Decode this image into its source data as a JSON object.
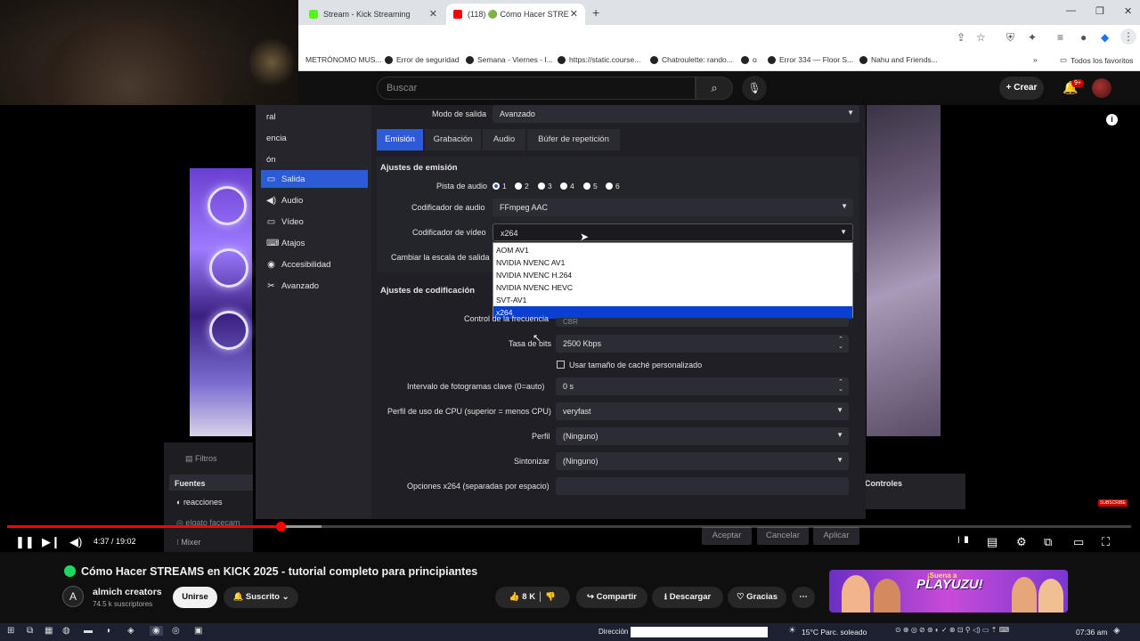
{
  "browser": {
    "tabs": [
      {
        "title": "Stream - Kick Streaming",
        "favicon_color": "#53fc18"
      },
      {
        "title": "(118) 🟢 Cómo Hacer STRE",
        "favicon_color": "#ff0000"
      }
    ],
    "bookmarks": [
      "METRÓNOMO MUS...",
      "Error de seguridad",
      "Semana - Viernes - I...",
      "https://static.course...",
      "Chatroulette: rando...",
      "o",
      "Error 334 — Floor S...",
      "Nahu and Friends...",
      "Todos los favoritos"
    ]
  },
  "youtube": {
    "search_placeholder": "Buscar",
    "create_label": "Crear",
    "notif_count": "9+"
  },
  "obs": {
    "sidebar": [
      {
        "label": "ral",
        "icon": "general-icon"
      },
      {
        "label": "encia",
        "icon": "stream-icon"
      },
      {
        "label": "ón",
        "icon": "output-icon"
      },
      {
        "label": "Salida",
        "icon": "output-icon"
      },
      {
        "label": "Audio",
        "icon": "speaker-icon"
      },
      {
        "label": "Vídeo",
        "icon": "monitor-icon"
      },
      {
        "label": "Atajos",
        "icon": "keyboard-icon"
      },
      {
        "label": "Accesibilidad",
        "icon": "accessibility-icon"
      },
      {
        "label": "Avanzado",
        "icon": "tools-icon"
      }
    ],
    "output_mode_label": "Modo de salida",
    "output_mode_value": "Avanzado",
    "tabs": [
      "Emisión",
      "Grabación",
      "Audio",
      "Búfer de repetición"
    ],
    "stream_section": "Ajustes de emisión",
    "audio_track_label": "Pista de audio",
    "audio_tracks": [
      "1",
      "2",
      "3",
      "4",
      "5",
      "6"
    ],
    "audio_encoder_label": "Codificador de audio",
    "audio_encoder_value": "FFmpeg AAC",
    "video_encoder_label": "Codificador de vídeo",
    "video_encoder_value": "x264",
    "rescale_label": "Cambiar la escala de salida",
    "encoder_options": [
      "AOM AV1",
      "NVIDIA NVENC AV1",
      "NVIDIA NVENC H.264",
      "NVIDIA NVENC HEVC",
      "SVT-AV1",
      "x264"
    ],
    "encoding_section": "Ajustes de codificación",
    "rate_control_label": "Control de la frecuencia",
    "rate_control_value": "CBR",
    "bitrate_label": "Tasa de bits",
    "bitrate_value": "2500 Kbps",
    "custom_buffer_label": "Usar tamaño de caché personalizado",
    "keyframe_label": "Intervalo de fotogramas clave (0=auto)",
    "keyframe_value": "0 s",
    "cpu_preset_label": "Perfil de uso de CPU (superior = menos CPU)",
    "cpu_preset_value": "veryfast",
    "profile_label": "Perfil",
    "profile_value": "(Ninguno)",
    "tune_label": "Sintonizar",
    "tune_value": "(Ninguno)",
    "x264_opts_label": "Opciones x264 (separadas por espacio)",
    "buttons": {
      "accept": "Aceptar",
      "cancel": "Cancelar",
      "apply": "Aplicar"
    },
    "filters_label": "Filtros",
    "sources_label": "Fuentes",
    "sources": [
      "reacciones",
      "elgato facecam"
    ],
    "mixer_label": "Mixer",
    "controls_label": "Controles"
  },
  "player": {
    "time": "4:37 / 19:02",
    "played_fraction": 0.243,
    "buffered_fraction": 0.28,
    "subscribe_mini": "SUBSCRIBE"
  },
  "video": {
    "title": "Cómo Hacer STREAMS en KICK 2025 - tutorial completo para principiantes",
    "channel": "almich creators",
    "subscribers": "74.5 k suscriptores",
    "join": "Unirse",
    "subscribed": "Suscrito",
    "likes": "8 K",
    "share": "Compartir",
    "download": "Descargar",
    "thanks": "Gracias"
  },
  "ad": {
    "tagline": "¡Suena a",
    "brand": "PLAYUZU!"
  },
  "taskbar": {
    "address_label": "Dirección",
    "weather": "15°C  Parc. soleado",
    "clock": "07:36 am"
  }
}
